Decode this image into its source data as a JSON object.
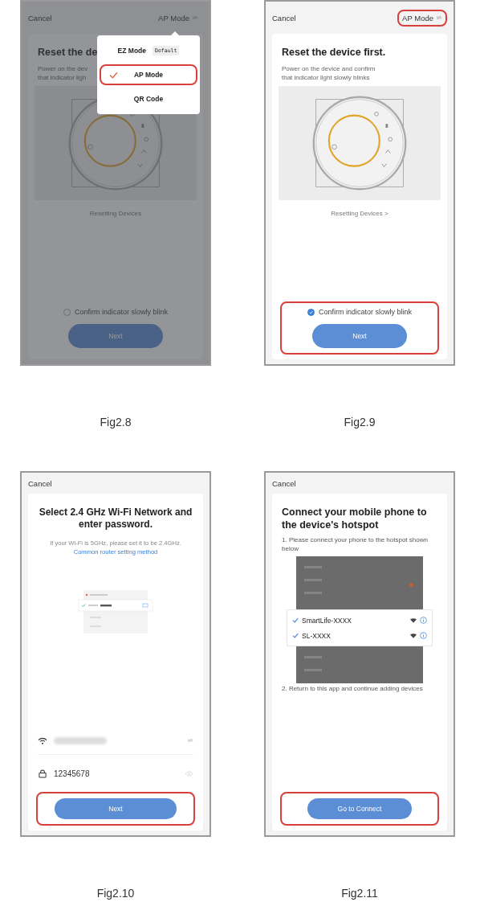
{
  "figures": [
    {
      "kind": "reset",
      "caption": "Fig2.8",
      "dimmed": true,
      "cancel": "Cancel",
      "mode": "AP Mode",
      "mode_highlighted": false,
      "title": "Reset the de",
      "description": [
        "Power on the dev",
        "that indicator ligh"
      ],
      "link": "Resetting Devices",
      "confirm": {
        "label": "Confirm indicator slowly blink",
        "checked": false
      },
      "bottom_highlighted": false,
      "button": "Next",
      "menu": {
        "items": [
          {
            "label": "EZ Mode",
            "badge": "Default",
            "selected": false,
            "highlighted": false
          },
          {
            "label": "AP Mode",
            "selected": true,
            "highlighted": true
          },
          {
            "label": "QR Code",
            "selected": false,
            "highlighted": false
          }
        ]
      }
    },
    {
      "kind": "reset",
      "caption": "Fig2.9",
      "cancel": "Cancel",
      "mode": "AP Mode",
      "mode_highlighted": true,
      "title": "Reset the device first.",
      "description": [
        "Power on the device and confirm",
        "that indicator light slowly blinks"
      ],
      "link": "Resetting Devices >",
      "confirm": {
        "label": "Confirm indicator slowly blink",
        "checked": true
      },
      "bottom_highlighted": true,
      "button": "Next"
    },
    {
      "kind": "wifi",
      "caption": "Fig2.10",
      "cancel": "Cancel",
      "title": "Select 2.4 GHz Wi-Fi Network and enter password.",
      "note": "If your Wi-Fi is 5GHz, please set it to be 2.4GHz.",
      "link": "Common router setting method",
      "password": "12345678",
      "button": "Next",
      "button_highlighted": true
    },
    {
      "kind": "hotspot",
      "caption": "Fig2.11",
      "cancel": "Cancel",
      "title": "Connect your mobile phone to the device's hotspot",
      "step1": "1. Please connect your phone to the hotspot shown below",
      "networks": [
        {
          "name": "SmartLife-XXXX",
          "checked": true
        },
        {
          "name": "SL-XXXX",
          "checked": true
        }
      ],
      "step2": "2. Return to this app and continue adding devices",
      "button": "Go to Connect",
      "button_highlighted": true
    }
  ]
}
